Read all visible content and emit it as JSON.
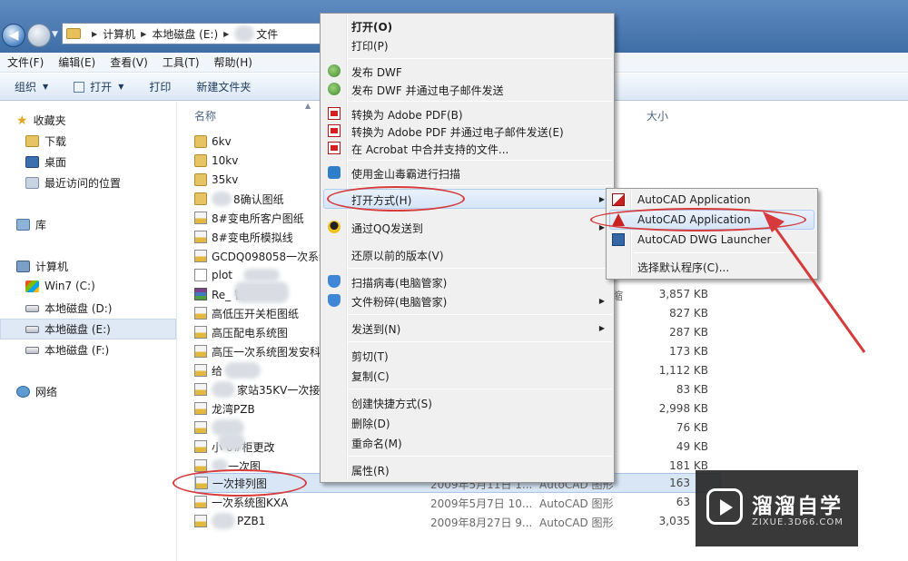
{
  "address": {
    "crumbs": [
      "计算机",
      "本地磁盘 (E:)",
      "文件"
    ]
  },
  "menubar": [
    "文件(F)",
    "编辑(E)",
    "查看(V)",
    "工具(T)",
    "帮助(H)"
  ],
  "toolbar": {
    "organize": "组织",
    "open": "打开",
    "print": "打印",
    "new_folder": "新建文件夹"
  },
  "nav": {
    "favorites": "收藏夹",
    "downloads": "下载",
    "desktop": "桌面",
    "recent": "最近访问的位置",
    "libraries": "库",
    "computer": "计算机",
    "drive_c": "Win7 (C:)",
    "drive_d": "本地磁盘 (D:)",
    "drive_e": "本地磁盘 (E:)",
    "drive_f": "本地磁盘 (F:)",
    "network": "网络"
  },
  "columns": {
    "name": "名称",
    "size": "大小"
  },
  "files": [
    {
      "name": "6kv",
      "icon": "folder"
    },
    {
      "name": "10kv",
      "icon": "folder"
    },
    {
      "name": "35kv",
      "icon": "folder"
    },
    {
      "name": "8确认图纸",
      "icon": "folder"
    },
    {
      "name": "8#变电所客户图纸",
      "icon": "dwg"
    },
    {
      "name": "8#变电所模拟线",
      "icon": "dwg"
    },
    {
      "name": "GCDQ098058一次系统",
      "icon": "dwg"
    },
    {
      "name": "plot",
      "icon": "txt"
    },
    {
      "name": "Re_ 智能操控",
      "icon": "rar",
      "size": "3,857 KB",
      "type": "缩"
    },
    {
      "name": "高低压开关柜图纸",
      "icon": "dwg",
      "size": "827 KB"
    },
    {
      "name": "高压配电系统图",
      "icon": "dwg",
      "size": "287 KB"
    },
    {
      "name": "高压一次系统图发安科",
      "icon": "dwg",
      "size": "173 KB"
    },
    {
      "name": "给",
      "icon": "dwg",
      "size": "1,112 KB"
    },
    {
      "name": "家站35KV一次接",
      "icon": "dwg",
      "size": "83 KB"
    },
    {
      "name": "龙湾PZB",
      "icon": "dwg",
      "size": "2,998 KB"
    },
    {
      "name": "",
      "icon": "dwg",
      "size": "76 KB"
    },
    {
      "name": "小 6#柜更改",
      "icon": "dwg",
      "size": "49 KB"
    },
    {
      "name": "一次图",
      "icon": "dwg",
      "size": "181 KB"
    },
    {
      "name": "一次排列图",
      "icon": "dwg",
      "date": "2009年5月11日 1...",
      "type": "AutoCAD 图形",
      "size": "163"
    },
    {
      "name": "一次系统图KXA",
      "icon": "dwg",
      "date": "2009年5月7日 10...",
      "type": "AutoCAD 图形",
      "size": "63"
    },
    {
      "name": "PZB1",
      "icon": "dwg",
      "date": "2009年8月27日 9...",
      "type": "AutoCAD 图形",
      "size": "3,035"
    }
  ],
  "context_menu": {
    "open": "打开(O)",
    "print": "打印(P)",
    "publish_dwf": "发布 DWF",
    "publish_dwf_email": "发布 DWF 并通过电子邮件发送",
    "to_pdf": "转换为 Adobe PDF(B)",
    "to_pdf_email": "转换为 Adobe PDF 并通过电子邮件发送(E)",
    "acrobat_merge": "在 Acrobat 中合并支持的文件...",
    "kingsoft_scan": "使用金山毒霸进行扫描",
    "open_with": "打开方式(H)",
    "qq_send": "通过QQ发送到",
    "restore": "还原以前的版本(V)",
    "scan_virus": "扫描病毒(电脑管家)",
    "shred": "文件粉碎(电脑管家)",
    "send_to": "发送到(N)",
    "cut": "剪切(T)",
    "copy": "复制(C)",
    "shortcut": "创建快捷方式(S)",
    "delete": "删除(D)",
    "rename": "重命名(M)",
    "properties": "属性(R)"
  },
  "submenu": {
    "acad1": "AutoCAD Application",
    "acad2": "AutoCAD Application",
    "launcher": "AutoCAD DWG Launcher",
    "choose_default": "选择默认程序(C)..."
  },
  "watermark": {
    "title": "溜溜自学",
    "url": "ZIXUE.3D66.COM"
  },
  "colors": {
    "annotation": "#d63a3a",
    "selection": "#d8e6f6",
    "titlebar": "#4a79b0"
  }
}
